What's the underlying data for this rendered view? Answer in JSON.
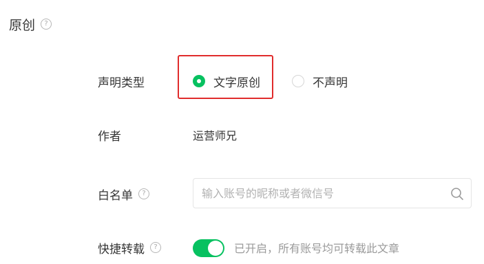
{
  "section": {
    "title": "原创",
    "help_glyph": "?"
  },
  "declaration": {
    "label": "声明类型",
    "options": [
      {
        "label": "文字原创",
        "checked": true
      },
      {
        "label": "不声明",
        "checked": false
      }
    ]
  },
  "author": {
    "label": "作者",
    "value": "运营师兄"
  },
  "whitelist": {
    "label": "白名单",
    "help_glyph": "?",
    "placeholder": "输入账号的昵称或者微信号",
    "search_icon": "search-icon"
  },
  "repost": {
    "label": "快捷转载",
    "help_glyph": "?",
    "enabled": true,
    "status_text": "已开启，所有账号均可转载此文章"
  },
  "colors": {
    "accent": "#07c160",
    "highlight": "#e02b2b",
    "text": "#353535",
    "muted": "#9a9a9a"
  }
}
